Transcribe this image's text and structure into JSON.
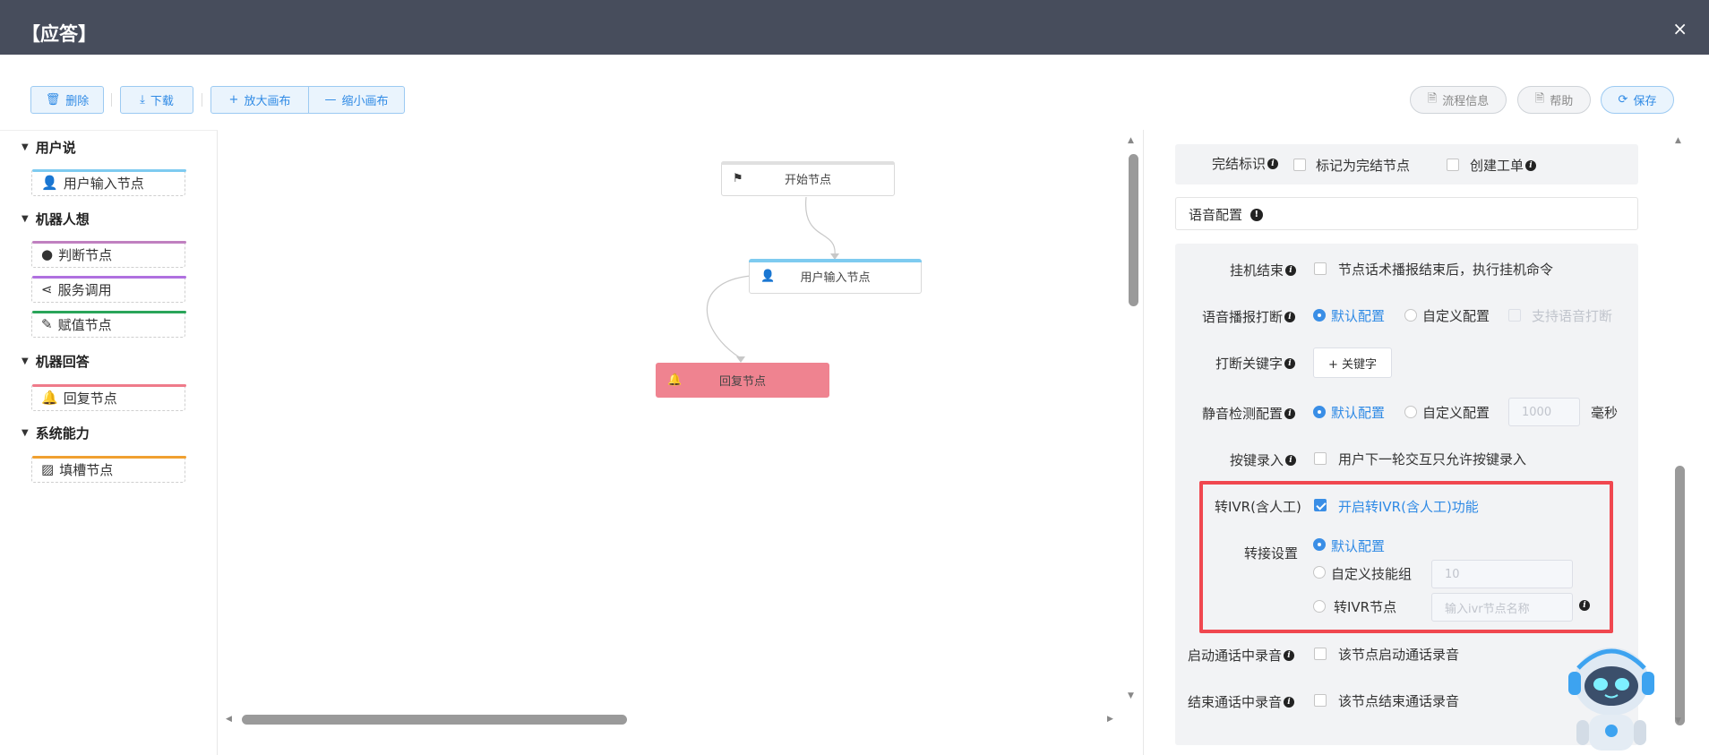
{
  "window": {
    "title": "【应答】",
    "close_label": "×"
  },
  "toolbar": {
    "delete": "删除",
    "download": "下载",
    "zoom_in": "放大画布",
    "zoom_out": "缩小画布",
    "flow_info": "流程信息",
    "help": "帮助",
    "save": "保存"
  },
  "palette": {
    "groups": [
      {
        "title": "用户说",
        "items": [
          {
            "label": "用户输入节点",
            "icon": "user-icon",
            "color": "#7ecbf0"
          }
        ]
      },
      {
        "title": "机器人想",
        "items": [
          {
            "label": "判断节点",
            "icon": "brain-icon",
            "color": "#c080c0"
          },
          {
            "label": "服务调用",
            "icon": "share-icon",
            "color": "#b070e0"
          },
          {
            "label": "赋值节点",
            "icon": "pencil-icon",
            "color": "#2aa55a"
          }
        ]
      },
      {
        "title": "机器回答",
        "items": [
          {
            "label": "回复节点",
            "icon": "bell-icon",
            "color": "#ef7a8a"
          }
        ]
      },
      {
        "title": "系统能力",
        "items": [
          {
            "label": "填槽节点",
            "icon": "chart-icon",
            "color": "#f0a030"
          }
        ]
      }
    ]
  },
  "canvas": {
    "nodes": {
      "start": "开始节点",
      "user_input": "用户输入节点",
      "reply": "回复节点"
    }
  },
  "panel": {
    "end_flag": {
      "label": "完结标识",
      "mark_end": "标记为完结节点",
      "create_ticket": "创建工单"
    },
    "voice_section": "语音配置",
    "hangup": {
      "label": "挂机结束",
      "text": "节点话术播报结束后，执行挂机命令"
    },
    "barge_in": {
      "label": "语音播报打断",
      "default": "默认配置",
      "custom": "自定义配置",
      "support": "支持语音打断"
    },
    "interrupt_kw": {
      "label": "打断关键字",
      "button": "+ 关键字"
    },
    "silence": {
      "label": "静音检测配置",
      "default": "默认配置",
      "custom": "自定义配置",
      "value": "1000",
      "unit": "毫秒"
    },
    "dtmf": {
      "label": "按键录入",
      "text": "用户下一轮交互只允许按键录入"
    },
    "ivr": {
      "label": "转IVR(含人工)",
      "text": "开启转IVR(含人工)功能"
    },
    "transfer": {
      "label": "转接设置",
      "default": "默认配置",
      "custom_skill": "自定义技能组",
      "skill_value": "10",
      "ivr_node": "转IVR节点",
      "ivr_node_placeholder": "输入ivr节点名称"
    },
    "record_start": {
      "label": "启动通话中录音",
      "text": "该节点启动通话录音"
    },
    "record_end": {
      "label": "结束通话中录音",
      "text": "该节点结束通话录音"
    }
  },
  "colors": {
    "header": "#474d5c",
    "accent": "#2f8ae5",
    "highlight": "#f0474f",
    "reply_node": "#ef8390"
  }
}
